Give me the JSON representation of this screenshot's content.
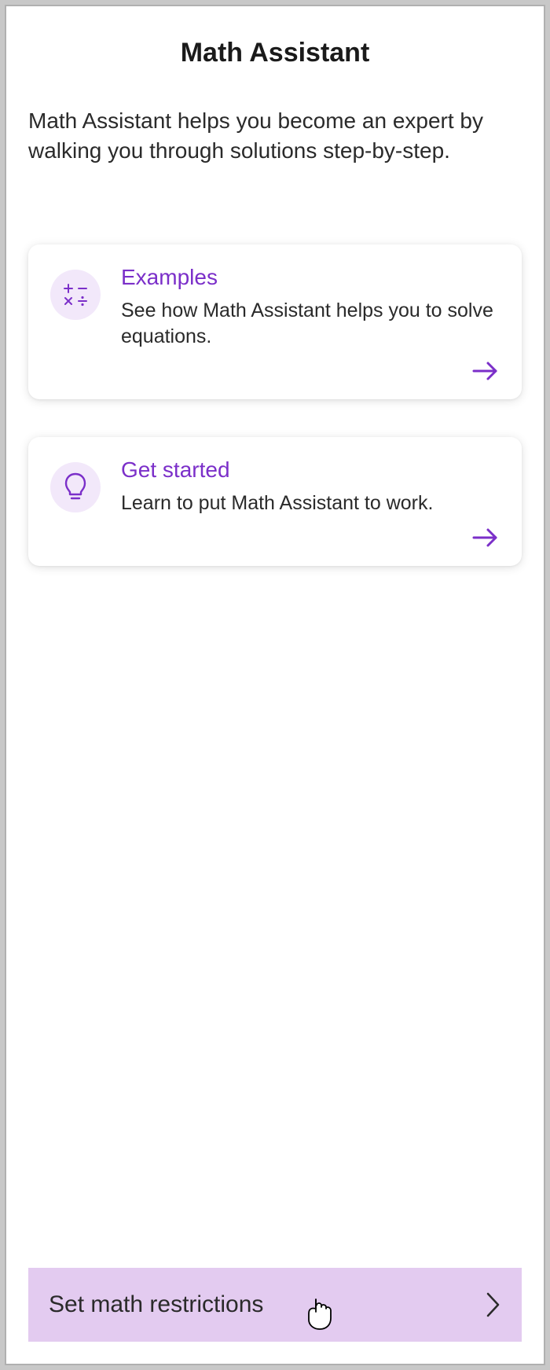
{
  "header": {
    "title": "Math Assistant",
    "description": "Math Assistant helps you become an expert by walking you through solutions step-by-step."
  },
  "cards": [
    {
      "icon": "math-operators-icon",
      "title": "Examples",
      "description": "See how Math Assistant helps you to solve equations."
    },
    {
      "icon": "lightbulb-icon",
      "title": "Get started",
      "description": "Learn to put Math Assistant to work."
    }
  ],
  "footer": {
    "label": "Set math restrictions"
  },
  "colors": {
    "accent": "#7b2fc9",
    "iconBg": "#f2e8fa",
    "footerBg": "#e3cbf0"
  }
}
